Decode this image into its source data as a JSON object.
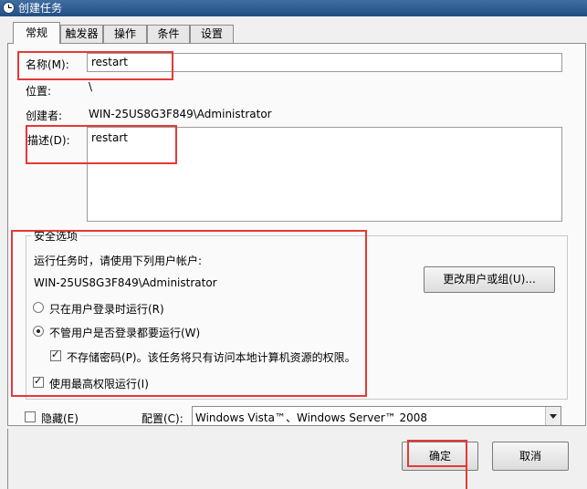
{
  "window": {
    "title": "创建任务"
  },
  "tabs": [
    "常规",
    "触发器",
    "操作",
    "条件",
    "设置"
  ],
  "general": {
    "name_label": "名称(M):",
    "name_value": "restart",
    "location_label": "位置:",
    "location_value": "\\",
    "author_label": "创建者:",
    "author_value": "WIN-25US8G3F849\\Administrator",
    "description_label": "描述(D):",
    "description_value": "restart"
  },
  "security": {
    "legend": "安全选项",
    "run_as_prompt": "运行任务时，请使用下列用户帐户:",
    "user_account": "WIN-25US8G3F849\\Administrator",
    "change_user_button": "更改用户或组(U)...",
    "radio_logged_on": "只在用户登录时运行(R)",
    "radio_whether_logged_on": "不管用户是否登录都要运行(W)",
    "selected_radio": "radio_whether_logged_on",
    "no_store_password": "不存储密码(P)。该任务将只有访问本地计算机资源的权限。",
    "highest_privileges": "使用最高权限运行(I)"
  },
  "footer": {
    "hidden_label": "隐藏(E)",
    "config_label": "配置(C):",
    "config_value": "Windows Vista™、Windows Server™ 2008",
    "ok_button": "确定",
    "cancel_button": "取消"
  },
  "colors": {
    "highlight": "#e53935",
    "titlebar": "#2f5d92"
  }
}
